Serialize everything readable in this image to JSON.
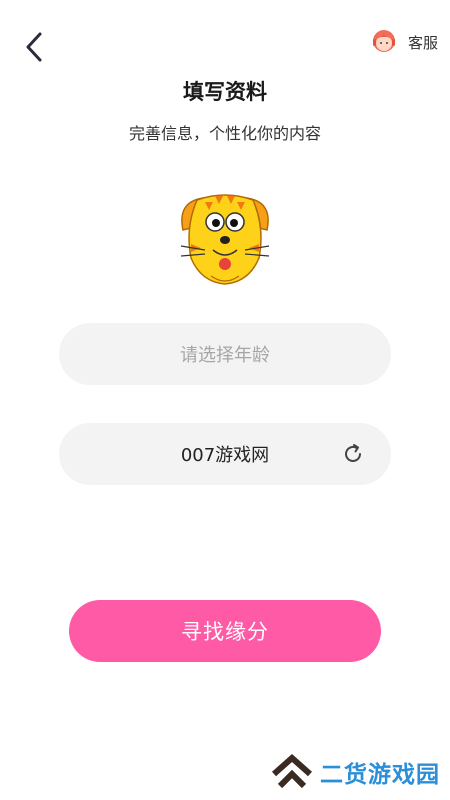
{
  "header": {
    "back_icon": "chevron-left-icon",
    "service_icon": "customer-service-avatar-icon",
    "service_label": "客服"
  },
  "page": {
    "title": "填写资料",
    "subtitle": "完善信息，个性化你的内容"
  },
  "avatar": {
    "icon": "cartoon-tiger-avatar"
  },
  "form": {
    "age_placeholder": "请选择年龄",
    "nickname_value": "007游戏网",
    "refresh_icon": "refresh-icon"
  },
  "cta": {
    "label": "寻找缘分",
    "color": "#ff5aa5"
  },
  "watermark": {
    "text": "二货游戏园",
    "color": "#2a8fd8"
  }
}
